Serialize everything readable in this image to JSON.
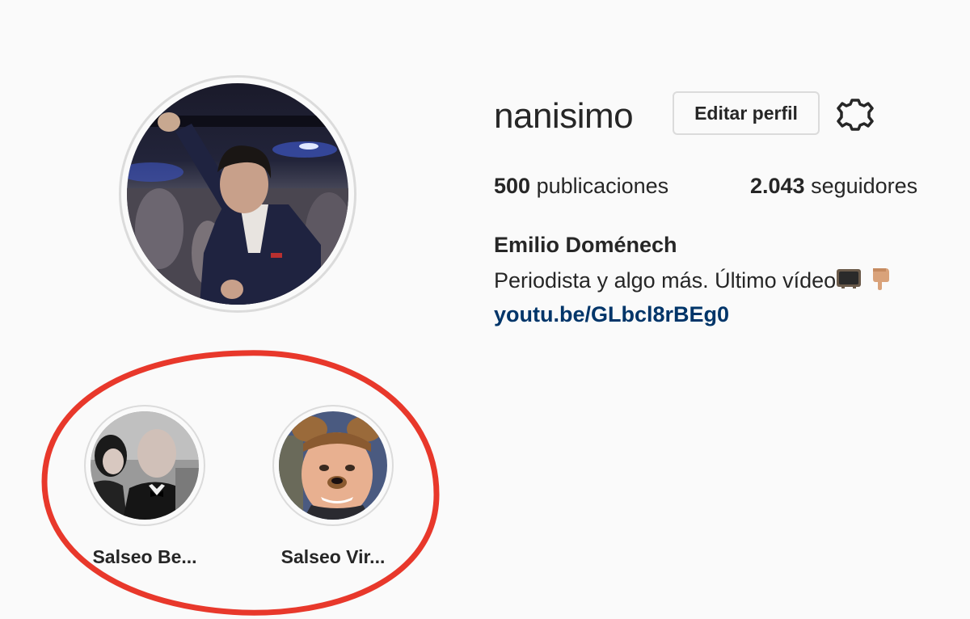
{
  "profile": {
    "username": "nanisimo",
    "edit_button_label": "Editar perfil",
    "settings_icon": "gear-icon",
    "stats": {
      "posts_count": "500",
      "posts_label": "publicaciones",
      "followers_count": "2.043",
      "followers_label": "seguidores"
    },
    "full_name": "Emilio Doménech",
    "bio_text": "Periodista y algo más. Último vídeo",
    "bio_emojis": [
      "television-emoji",
      "pointing-down-hand-emoji"
    ],
    "link": "youtu.be/GLbcl8rBEg0"
  },
  "highlights": [
    {
      "label": "Salseo Be..."
    },
    {
      "label": "Salseo Vir..."
    }
  ],
  "colors": {
    "background": "#fafafa",
    "text": "#262626",
    "link": "#003569",
    "border": "#dbdbdb",
    "annotation": "#e8382b"
  }
}
